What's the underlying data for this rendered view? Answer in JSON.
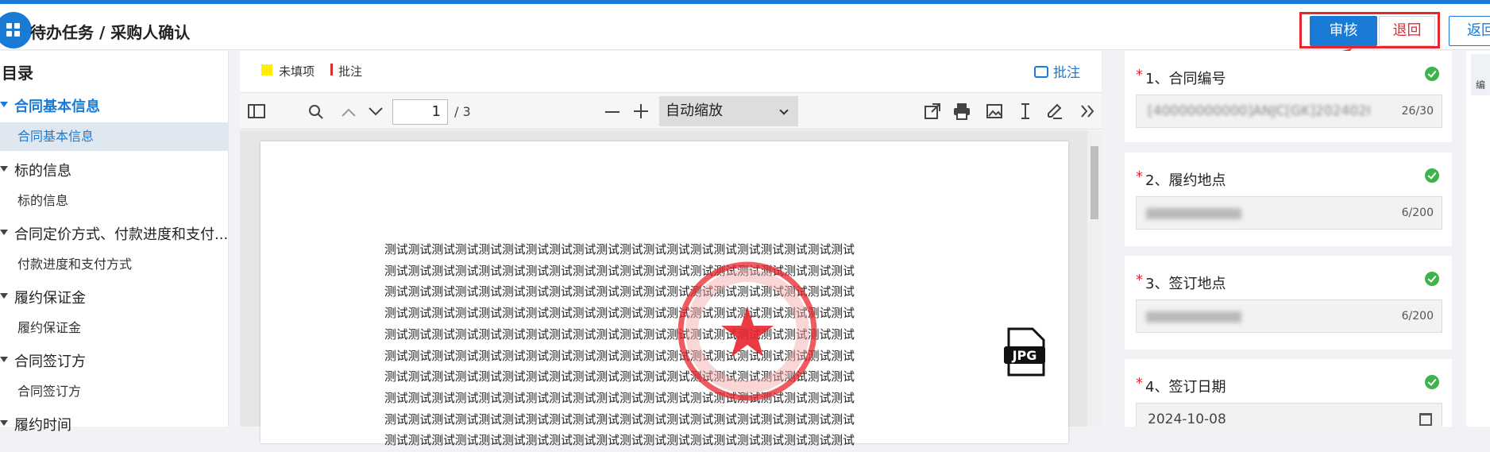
{
  "header": {
    "title": "待办任务 / 采购人确认",
    "approve_label": "审核",
    "return_label": "退回",
    "back_label": "返回"
  },
  "sidebar": {
    "title": "目录",
    "items": [
      {
        "level": 1,
        "label": "合同基本信息",
        "active": true
      },
      {
        "level": 2,
        "label": "合同基本信息",
        "active": true
      },
      {
        "level": 1,
        "label": "标的信息"
      },
      {
        "level": 2,
        "label": "标的信息"
      },
      {
        "level": 1,
        "label": "合同定价方式、付款进度和支付..."
      },
      {
        "level": 2,
        "label": "付款进度和支付方式"
      },
      {
        "level": 1,
        "label": "履约保证金"
      },
      {
        "level": 2,
        "label": "履约保证金"
      },
      {
        "level": 1,
        "label": "合同签订方"
      },
      {
        "level": 2,
        "label": "合同签订方"
      },
      {
        "level": 1,
        "label": "履约时间"
      }
    ]
  },
  "viewer": {
    "legend_unfilled": "未填项",
    "legend_note": "批注",
    "note_button": "批注",
    "page_current": "1",
    "page_total": "/ 3",
    "zoom_label": "自动缩放",
    "body_text": "测试测试测试测试测试测试测试测试测试测试测试测试测试测试测试测试测试测试测试测试",
    "stamp_color": "#e8262e",
    "attachment_icon": "jpg-file-icon",
    "attachment_label": "JPG"
  },
  "fields": [
    {
      "label": "1、合同编号",
      "value": "[40000000000]ANJC[GK]2024020",
      "count": "26/30",
      "blurred": true
    },
    {
      "label": "2、履约地点",
      "value": "",
      "count": "6/200",
      "blurred": true
    },
    {
      "label": "3、签订地点",
      "value": "",
      "count": "6/200",
      "blurred": true
    },
    {
      "label": "4、签订日期",
      "value": "2024-10-08",
      "count": "",
      "blurred": false
    }
  ],
  "far_right": {
    "tab_label": "编"
  },
  "colors": {
    "accent": "#1a7bd6",
    "danger": "#e8262e",
    "ok": "#3cb44b"
  }
}
